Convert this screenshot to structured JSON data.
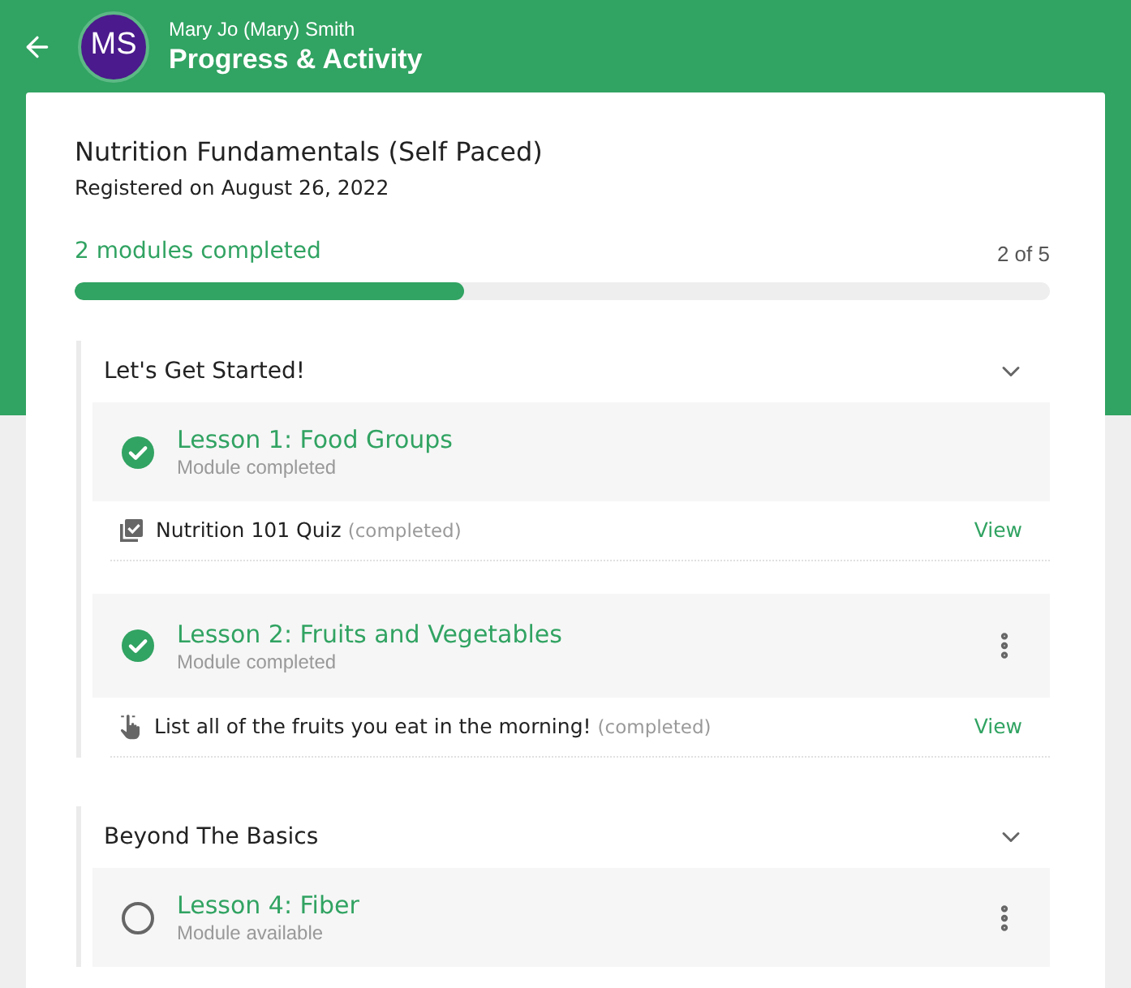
{
  "header": {
    "avatar": {
      "initials": "MS"
    },
    "user_name": "Mary Jo (Mary) Smith",
    "title": "Progress & Activity"
  },
  "course": {
    "title": "Nutrition Fundamentals (Self Paced)",
    "registered": "Registered on August 26, 2022"
  },
  "progress": {
    "label": "2 modules completed",
    "count": "2 of 5",
    "level": 0.4
  },
  "sections": [
    {
      "title": "Let's Get Started!",
      "expanded": true,
      "lessons": [
        {
          "title": "Lesson 1: Food Groups",
          "status": "Module completed",
          "completed": true,
          "menu": false,
          "activities": [
            {
              "kind": "quiz",
              "title": "Nutrition 101 Quiz",
              "status": "(completed)",
              "action": "View"
            }
          ]
        },
        {
          "title": "Lesson 2: Fruits and Vegetables",
          "status": "Module completed",
          "completed": true,
          "menu": true,
          "activities": [
            {
              "kind": "activity",
              "title": "List all of the fruits you eat in the morning!",
              "status": "(completed)",
              "action": "View"
            }
          ]
        }
      ]
    },
    {
      "title": "Beyond The Basics",
      "expanded": true,
      "lessons": [
        {
          "title": "Lesson 4: Fiber",
          "status": "Module available",
          "completed": false,
          "menu": true
        }
      ]
    }
  ]
}
